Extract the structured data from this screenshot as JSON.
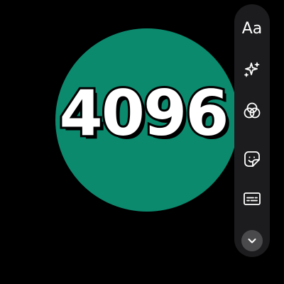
{
  "canvas": {
    "background": "#000000",
    "circle_color": "#0b8a6e",
    "main_text": "4096",
    "text_color": "#ffffff",
    "outline_color": "#000000"
  },
  "toolbar": {
    "background": "#1c1c1e",
    "icon_color": "#ffffff",
    "text_tool_label": "Aa",
    "tools": [
      {
        "id": "text",
        "icon": "text-icon"
      },
      {
        "id": "effects",
        "icon": "sparkle-icon"
      },
      {
        "id": "filters",
        "icon": "color-circles-icon"
      },
      {
        "id": "stickers",
        "icon": "sticker-icon"
      },
      {
        "id": "captions",
        "icon": "captions-icon"
      }
    ],
    "collapse_icon": "chevron-down-icon",
    "collapse_button_color": "#4a4a4c"
  }
}
